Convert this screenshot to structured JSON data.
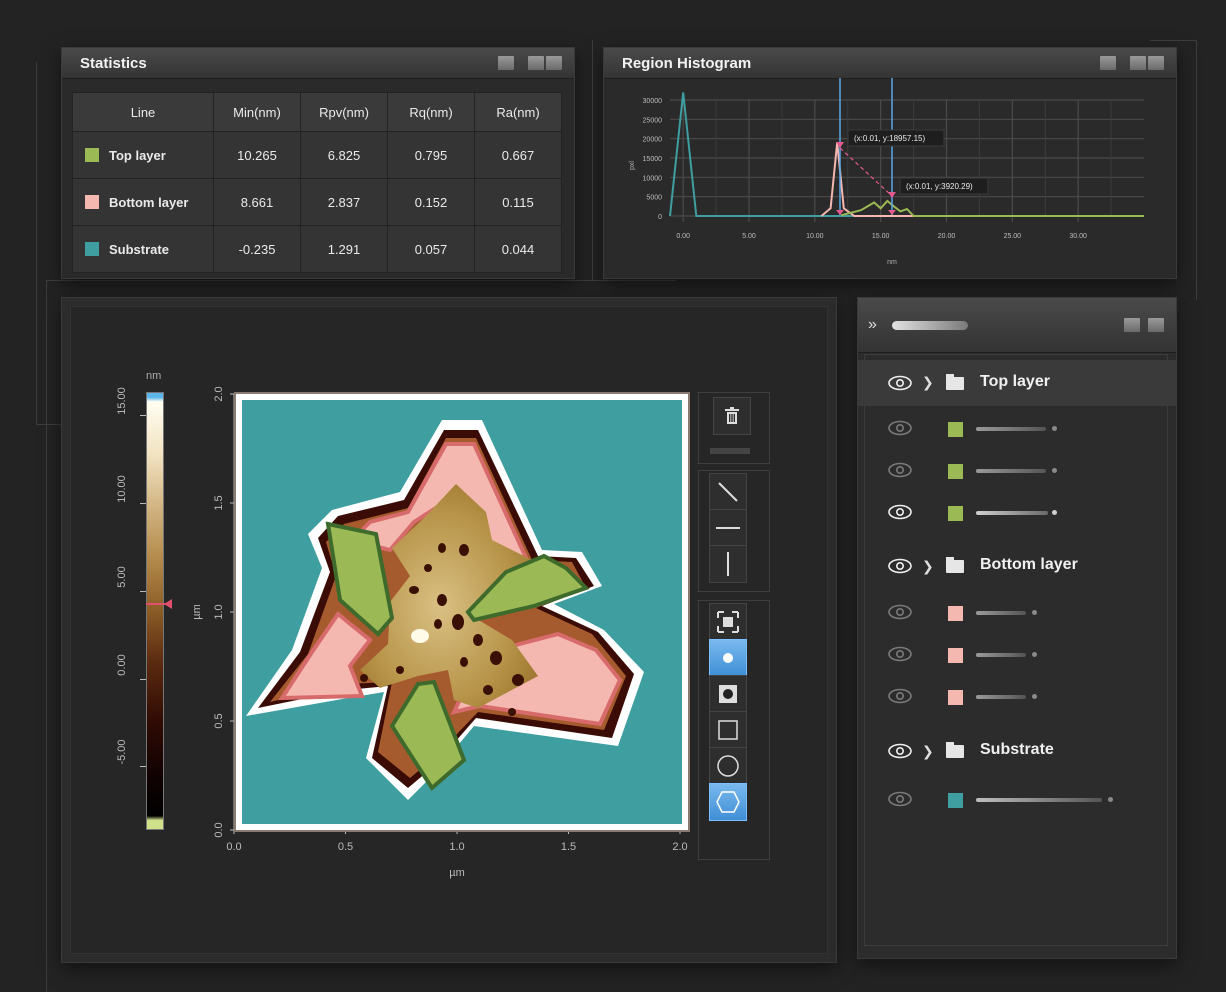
{
  "statistics": {
    "title": "Statistics",
    "columns": [
      "Line",
      "Min(nm)",
      "Rpv(nm)",
      "Rq(nm)",
      "Ra(nm)"
    ],
    "rows": [
      {
        "name": "Top layer",
        "color": "#9bb954",
        "min": "10.265",
        "rpv": "6.825",
        "rq": "0.795",
        "ra": "0.667"
      },
      {
        "name": "Bottom layer",
        "color": "#f4b8b0",
        "min": "8.661",
        "rpv": "2.837",
        "rq": "0.152",
        "ra": "0.115"
      },
      {
        "name": "Substrate",
        "color": "#3e9ea0",
        "min": "-0.235",
        "rpv": "1.291",
        "rq": "0.057",
        "ra": "0.044"
      }
    ]
  },
  "histogram": {
    "title": "Region Histogram",
    "y_ticks": [
      "30000",
      "25000",
      "20000",
      "15000",
      "10000",
      "5000",
      "0"
    ],
    "x_ticks": [
      "0.00",
      "5.00",
      "10.00",
      "15.00",
      "20.00",
      "25.00",
      "30.00"
    ],
    "xlabel": "nm",
    "ylabel": "pxl",
    "tooltip1": "(x:0.01,  y:18957.15)",
    "tooltip2": "(x:0.01,  y:3920.29)"
  },
  "image_view": {
    "colorbar_unit": "nm",
    "colorbar_ticks": [
      "15.00",
      "10.00",
      "5.00",
      "0.00",
      "-5.00"
    ],
    "y_ticks": [
      "2.0",
      "1.5",
      "1.0",
      "0.5",
      "0.0"
    ],
    "x_ticks": [
      "0.0",
      "0.5",
      "1.0",
      "1.5",
      "2.0"
    ],
    "xlabel": "µm",
    "ylabel": "µm"
  },
  "layers": {
    "groups": [
      {
        "label": "Top layer",
        "color": "#9bb954"
      },
      {
        "label": "Bottom layer",
        "color": "#f4b8b0"
      },
      {
        "label": "Substrate",
        "color": "#3e9ea0"
      }
    ]
  },
  "chart_data": {
    "type": "line",
    "title": "Region Histogram",
    "xlabel": "nm",
    "ylabel": "pxl",
    "xlim": [
      -1,
      35
    ],
    "ylim": [
      0,
      30000
    ],
    "series": [
      {
        "name": "Substrate",
        "color": "#3e9ea0",
        "x": [
          -1,
          0,
          1,
          2,
          10,
          20,
          35
        ],
        "y": [
          0,
          32000,
          0,
          0,
          0,
          0,
          0
        ]
      },
      {
        "name": "Bottom layer",
        "color": "#f4b8b0",
        "x": [
          10.5,
          11.2,
          11.7,
          12.2,
          13,
          20,
          35
        ],
        "y": [
          0,
          2000,
          19000,
          2000,
          0,
          0,
          0
        ]
      },
      {
        "name": "Top layer",
        "color": "#9bb954",
        "x": [
          12,
          13.5,
          14.5,
          15,
          15.5,
          16,
          16.5,
          17,
          17.5,
          20,
          35
        ],
        "y": [
          200,
          1500,
          3500,
          2000,
          3900,
          2500,
          1200,
          1800,
          0,
          0,
          0
        ]
      }
    ]
  }
}
